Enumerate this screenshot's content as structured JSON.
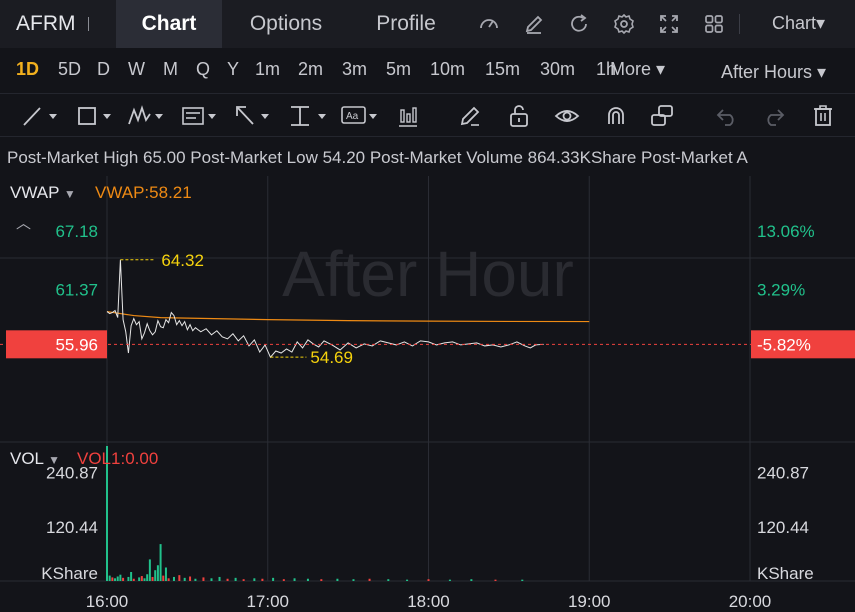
{
  "header": {
    "ticker": "AFRM",
    "tabs": [
      {
        "label": "Chart",
        "active": true
      },
      {
        "label": "Options",
        "active": false
      },
      {
        "label": "Profile",
        "active": false
      }
    ],
    "icons": [
      "gauge-icon",
      "pencil-edit-icon",
      "refresh-icon",
      "gear-icon",
      "expand-icon",
      "grid-icon"
    ],
    "chart_menu": "Chart▾"
  },
  "timeframes": {
    "items": [
      "1D",
      "5D",
      "D",
      "W",
      "M",
      "Q",
      "Y",
      "1m",
      "2m",
      "3m",
      "5m",
      "10m",
      "15m",
      "30m",
      "1h"
    ],
    "active": "1D",
    "more": "More ▾",
    "session": "After Hours ▾"
  },
  "tools": [
    "trend-line-icon",
    "rectangle-icon",
    "pattern-icon",
    "fib-icon",
    "arrow-icon",
    "measure-icon",
    "text-icon",
    "indicator-icon",
    "pen-icon",
    "lock-icon",
    "eye-icon",
    "magnet-icon",
    "link-icon",
    "undo-icon",
    "redo-icon",
    "trash-icon"
  ],
  "stats": {
    "text": "Post-Market High 65.00 Post-Market Low 54.20 Post-Market Volume 864.33KShare Post-Market A"
  },
  "watermark": "After Hour",
  "colors": {
    "background": "#131419",
    "header": "#1b1c22",
    "accent": "#f2b01e",
    "vwap": "#ee8a14",
    "up": "#21c18b",
    "down": "#f0413e",
    "price_line": "#e6e6e6",
    "annotation": "#f5d20d"
  },
  "chart_data": {
    "type": "line",
    "price_panel": {
      "indicator": "VWAP",
      "indicator_value_label": "VWAP:58.21",
      "left_ticks": [
        "67.18",
        "61.37"
      ],
      "right_ticks": [
        "13.06%",
        "3.29%"
      ],
      "current_price": "55.96",
      "current_change": "-5.82%",
      "high_annotation": "64.32",
      "low_annotation": "54.69",
      "ylim": [
        46.5,
        72.6
      ],
      "x_range": [
        "16:00",
        "20:00"
      ],
      "x_minutes": [
        0,
        240
      ],
      "price_series": {
        "x": [
          0,
          1,
          2,
          3,
          4,
          5,
          6,
          7,
          8,
          9,
          10,
          11,
          12,
          13,
          14,
          15,
          16,
          17,
          18,
          19,
          20,
          21,
          22,
          23,
          24,
          25,
          26,
          27,
          28,
          29,
          30,
          31,
          32,
          33,
          35,
          37,
          39,
          41,
          43,
          45,
          47,
          49,
          51,
          53,
          55,
          57,
          59,
          61,
          63,
          65,
          67,
          69,
          71,
          73,
          75,
          77,
          79,
          81,
          84,
          87,
          90,
          93,
          96,
          99,
          102,
          105,
          108,
          111,
          114,
          117,
          120,
          123,
          126,
          129,
          132,
          135,
          138,
          141,
          144,
          147,
          150,
          153,
          156,
          158,
          160,
          163
        ],
        "y": [
          59.2,
          59.0,
          59.1,
          59.3,
          58.6,
          64.32,
          58.4,
          57.2,
          55.1,
          57.8,
          58.5,
          57.9,
          58.2,
          56.5,
          57.1,
          58.0,
          57.3,
          56.9,
          57.2,
          58.3,
          57.7,
          57.6,
          58.4,
          58.1,
          59.1,
          58.8,
          57.9,
          58.3,
          57.8,
          58.2,
          57.4,
          57.9,
          57.3,
          57.6,
          57.2,
          57.5,
          56.9,
          57.3,
          56.7,
          56.5,
          57.0,
          56.3,
          56.8,
          55.8,
          56.4,
          55.2,
          55.9,
          54.69,
          55.3,
          55.1,
          55.5,
          55.2,
          56.2,
          55.6,
          56.4,
          56.0,
          55.7,
          56.3,
          55.9,
          55.4,
          56.1,
          55.6,
          56.0,
          55.8,
          56.3,
          56.1,
          55.9,
          56.2,
          55.8,
          56.3,
          56.2,
          55.9,
          56.1,
          56.2,
          55.9,
          56.0,
          56.1,
          55.8,
          55.9,
          55.7,
          55.9,
          56.2,
          55.8,
          55.6,
          55.9,
          55.96
        ]
      },
      "vwap_series": {
        "x": [
          0,
          5,
          10,
          20,
          40,
          60,
          90,
          120,
          150,
          180
        ],
        "y": [
          59.2,
          59.0,
          58.8,
          58.6,
          58.5,
          58.4,
          58.3,
          58.25,
          58.22,
          58.21
        ]
      }
    },
    "volume_panel": {
      "indicator": "VOL",
      "indicator_value_label": "VOL1:0.00",
      "ticks": [
        "240.87",
        "120.44"
      ],
      "unit": "KShare",
      "ylim": [
        0,
        300
      ],
      "bars": [
        {
          "x": 0,
          "v": 300,
          "up": true
        },
        {
          "x": 1,
          "v": 12,
          "up": true
        },
        {
          "x": 2,
          "v": 8,
          "up": false
        },
        {
          "x": 3,
          "v": 6,
          "up": true
        },
        {
          "x": 4,
          "v": 10,
          "up": true
        },
        {
          "x": 5,
          "v": 14,
          "up": true
        },
        {
          "x": 6,
          "v": 7,
          "up": false
        },
        {
          "x": 8,
          "v": 9,
          "up": true
        },
        {
          "x": 9,
          "v": 20,
          "up": true
        },
        {
          "x": 10,
          "v": 5,
          "up": false
        },
        {
          "x": 12,
          "v": 8,
          "up": true
        },
        {
          "x": 13,
          "v": 11,
          "up": false
        },
        {
          "x": 14,
          "v": 6,
          "up": true
        },
        {
          "x": 15,
          "v": 15,
          "up": true
        },
        {
          "x": 16,
          "v": 48,
          "up": true
        },
        {
          "x": 17,
          "v": 9,
          "up": false
        },
        {
          "x": 18,
          "v": 24,
          "up": true
        },
        {
          "x": 19,
          "v": 35,
          "up": true
        },
        {
          "x": 20,
          "v": 82,
          "up": true
        },
        {
          "x": 21,
          "v": 12,
          "up": false
        },
        {
          "x": 22,
          "v": 30,
          "up": true
        },
        {
          "x": 23,
          "v": 6,
          "up": false
        },
        {
          "x": 25,
          "v": 9,
          "up": true
        },
        {
          "x": 27,
          "v": 13,
          "up": false
        },
        {
          "x": 29,
          "v": 7,
          "up": true
        },
        {
          "x": 31,
          "v": 10,
          "up": false
        },
        {
          "x": 33,
          "v": 5,
          "up": true
        },
        {
          "x": 36,
          "v": 8,
          "up": false
        },
        {
          "x": 39,
          "v": 6,
          "up": true
        },
        {
          "x": 42,
          "v": 9,
          "up": true
        },
        {
          "x": 45,
          "v": 5,
          "up": false
        },
        {
          "x": 48,
          "v": 7,
          "up": true
        },
        {
          "x": 51,
          "v": 4,
          "up": false
        },
        {
          "x": 55,
          "v": 6,
          "up": true
        },
        {
          "x": 58,
          "v": 5,
          "up": false
        },
        {
          "x": 62,
          "v": 7,
          "up": true
        },
        {
          "x": 66,
          "v": 4,
          "up": false
        },
        {
          "x": 70,
          "v": 6,
          "up": true
        },
        {
          "x": 75,
          "v": 5,
          "up": true
        },
        {
          "x": 80,
          "v": 4,
          "up": false
        },
        {
          "x": 86,
          "v": 5,
          "up": true
        },
        {
          "x": 92,
          "v": 4,
          "up": true
        },
        {
          "x": 98,
          "v": 5,
          "up": false
        },
        {
          "x": 105,
          "v": 4,
          "up": true
        },
        {
          "x": 112,
          "v": 3,
          "up": true
        },
        {
          "x": 120,
          "v": 4,
          "up": false
        },
        {
          "x": 128,
          "v": 3,
          "up": true
        },
        {
          "x": 136,
          "v": 4,
          "up": true
        },
        {
          "x": 145,
          "v": 3,
          "up": false
        },
        {
          "x": 155,
          "v": 3,
          "up": true
        }
      ]
    },
    "x_ticks": [
      "16:00",
      "17:00",
      "18:00",
      "19:00",
      "20:00"
    ],
    "grid": true
  }
}
